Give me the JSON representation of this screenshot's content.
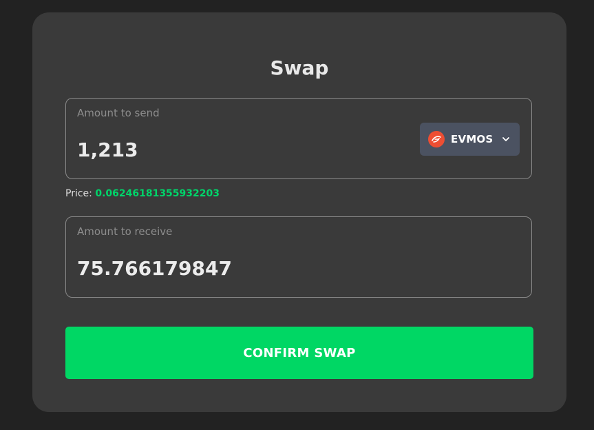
{
  "swap": {
    "title": "Swap",
    "send": {
      "label": "Amount to send",
      "value": "1,213",
      "token": {
        "symbol": "EVMOS",
        "icon": "evmos-logo-icon",
        "icon_color": "#ed4e33"
      }
    },
    "price": {
      "label": "Price:",
      "value": "0.06246181355932203",
      "value_color": "#00d46a"
    },
    "receive": {
      "label": "Amount to receive",
      "value": "75.766179847"
    },
    "confirm_label": "CONFIRM SWAP",
    "confirm_color": "#00d764"
  }
}
